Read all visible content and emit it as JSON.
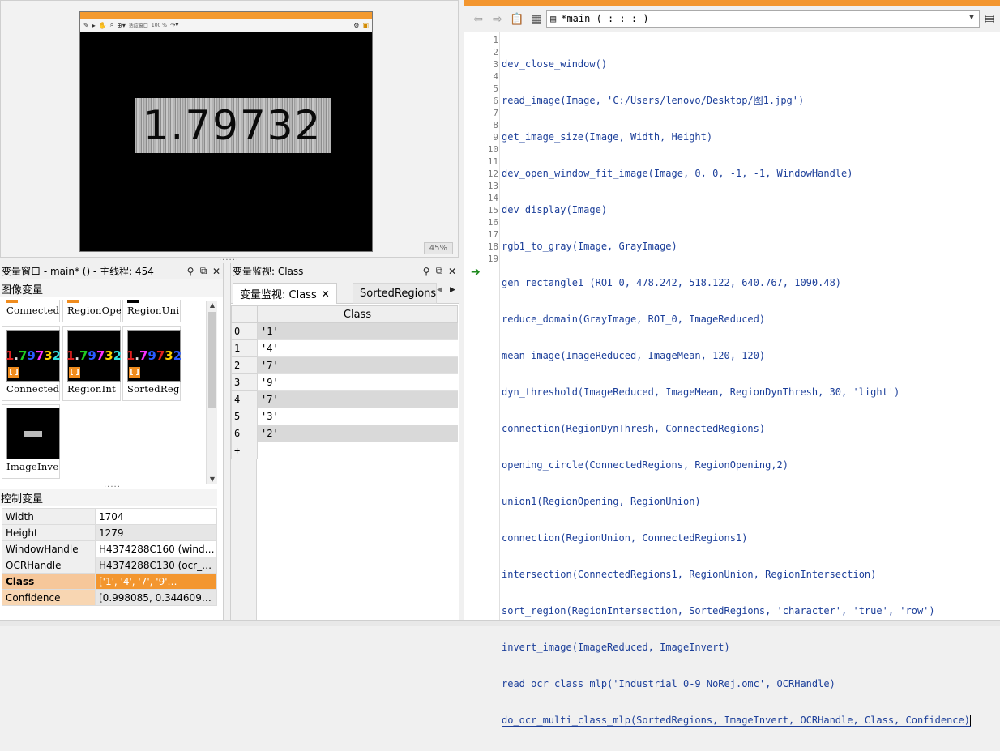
{
  "graphics_window": {
    "toolbar_icons": [
      "wand-icon",
      "pointer-icon",
      "pan-icon",
      "zoom-icon",
      "zoom-select-icon"
    ],
    "toolbar_text_1": "适应窗口",
    "toolbar_text_2": "100 %",
    "image_text": "1.79732",
    "zoom": "45%"
  },
  "variable_window": {
    "title": "变量窗口 - main* () - 主线程: 454",
    "iconic_section": "图像变量",
    "iconic_vars": [
      {
        "name": "Connected"
      },
      {
        "name": "RegionOpe"
      },
      {
        "name": "RegionUni"
      },
      {
        "name": "Connected"
      },
      {
        "name": "RegionInt"
      },
      {
        "name": "SortedReg"
      },
      {
        "name": "ImageInve"
      }
    ],
    "control_section": "控制变量",
    "control_vars": [
      {
        "name": "Width",
        "value": "1704"
      },
      {
        "name": "Height",
        "value": "1279"
      },
      {
        "name": "WindowHandle",
        "value": "H4374288C160 (windo…"
      },
      {
        "name": "OCRHandle",
        "value": "H4374288C130 (ocr_m…"
      },
      {
        "name": "Class",
        "value": "['1', '4', '7', '9'…"
      },
      {
        "name": "Confidence",
        "value": "[0.998085, 0.344609…"
      }
    ]
  },
  "inspect_window": {
    "title": "变量监视: Class",
    "tab_active": "变量监视: Class",
    "tab_other": "SortedRegions",
    "column_header": "Class",
    "rows": [
      {
        "idx": "0",
        "val": "'1'"
      },
      {
        "idx": "1",
        "val": "'4'"
      },
      {
        "idx": "2",
        "val": "'7'"
      },
      {
        "idx": "3",
        "val": "'9'"
      },
      {
        "idx": "4",
        "val": "'7'"
      },
      {
        "idx": "5",
        "val": "'3'"
      },
      {
        "idx": "6",
        "val": "'2'"
      },
      {
        "idx": "+",
        "val": ""
      }
    ]
  },
  "program_window": {
    "procedure": "*main ( : : : )",
    "lines": [
      "dev_close_window()",
      "read_image(Image, 'C:/Users/lenovo/Desktop/图1.jpg')",
      "get_image_size(Image, Width, Height)",
      "dev_open_window_fit_image(Image, 0, 0, -1, -1, WindowHandle)",
      "dev_display(Image)",
      "rgb1_to_gray(Image, GrayImage)",
      "gen_rectangle1 (ROI_0, 478.242, 518.122, 640.767, 1090.48)",
      "reduce_domain(GrayImage, ROI_0, ImageReduced)",
      "mean_image(ImageReduced, ImageMean, 120, 120)",
      "dyn_threshold(ImageReduced, ImageMean, RegionDynThresh, 30, 'light')",
      "connection(RegionDynThresh, ConnectedRegions)",
      "opening_circle(ConnectedRegions, RegionOpening,2)",
      "union1(RegionOpening, RegionUnion)",
      "connection(RegionUnion, ConnectedRegions1)",
      "intersection(ConnectedRegions1, RegionUnion, RegionIntersection)",
      "sort_region(RegionIntersection, SortedRegions, 'character', 'true', 'row')",
      "invert_image(ImageReduced, ImageInvert)",
      "read_ocr_class_mlp('Industrial_0-9_NoRej.omc', OCRHandle)",
      "do_ocr_multi_class_mlp(SortedRegions, ImageInvert, OCRHandle, Class, Confidence)"
    ]
  },
  "colors": {
    "accent_orange": "#f3962f",
    "code_blue": "#1c3f9a",
    "pc_green": "#1f8a1f"
  }
}
